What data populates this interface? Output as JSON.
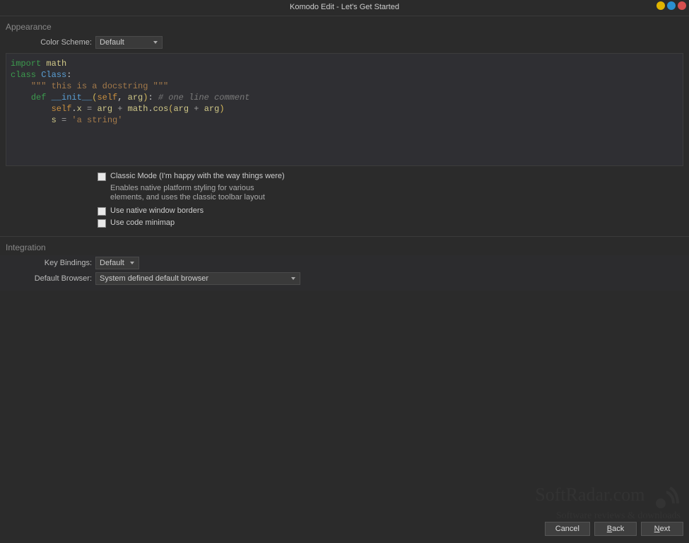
{
  "title": "Komodo Edit - Let's Get Started",
  "sections": {
    "appearance": "Appearance",
    "integration": "Integration"
  },
  "appearance": {
    "color_scheme_label": "Color Scheme:",
    "color_scheme_value": "Default",
    "classic_mode_label": "Classic Mode (I'm happy with the way things were)",
    "classic_mode_desc": "Enables native platform styling for various elements, and uses the classic toolbar layout",
    "native_borders_label": "Use native window borders",
    "minimap_label": "Use code minimap"
  },
  "code": {
    "l1_kw": "import",
    "l1_mod": "math",
    "l2_kw": "class",
    "l2_name": "Class",
    "l2_colon": ":",
    "l3_doc": "\"\"\" this is a docstring \"\"\"",
    "l4_kw": "def",
    "l4_fn": "__init__",
    "l4_self": "self",
    "l4_arg": "arg",
    "l4_comment": "# one line comment",
    "l5_self": "self",
    "l5_x": "x",
    "l5_eq": "=",
    "l5_arg": "arg",
    "l5_plus1": "+",
    "l5_math": "math",
    "l5_cos": "cos",
    "l5_plus2": "+",
    "l6_s": "s",
    "l6_eq": "=",
    "l6_str": "'a string'"
  },
  "integration": {
    "key_bindings_label": "Key Bindings:",
    "key_bindings_value": "Default",
    "browser_label": "Default Browser:",
    "browser_value": "System defined default browser"
  },
  "buttons": {
    "cancel": "Cancel",
    "back": "Back",
    "next": "Next"
  },
  "watermark": {
    "line1": "SoftRadar.com",
    "line2": "Software reviews & downloads"
  }
}
